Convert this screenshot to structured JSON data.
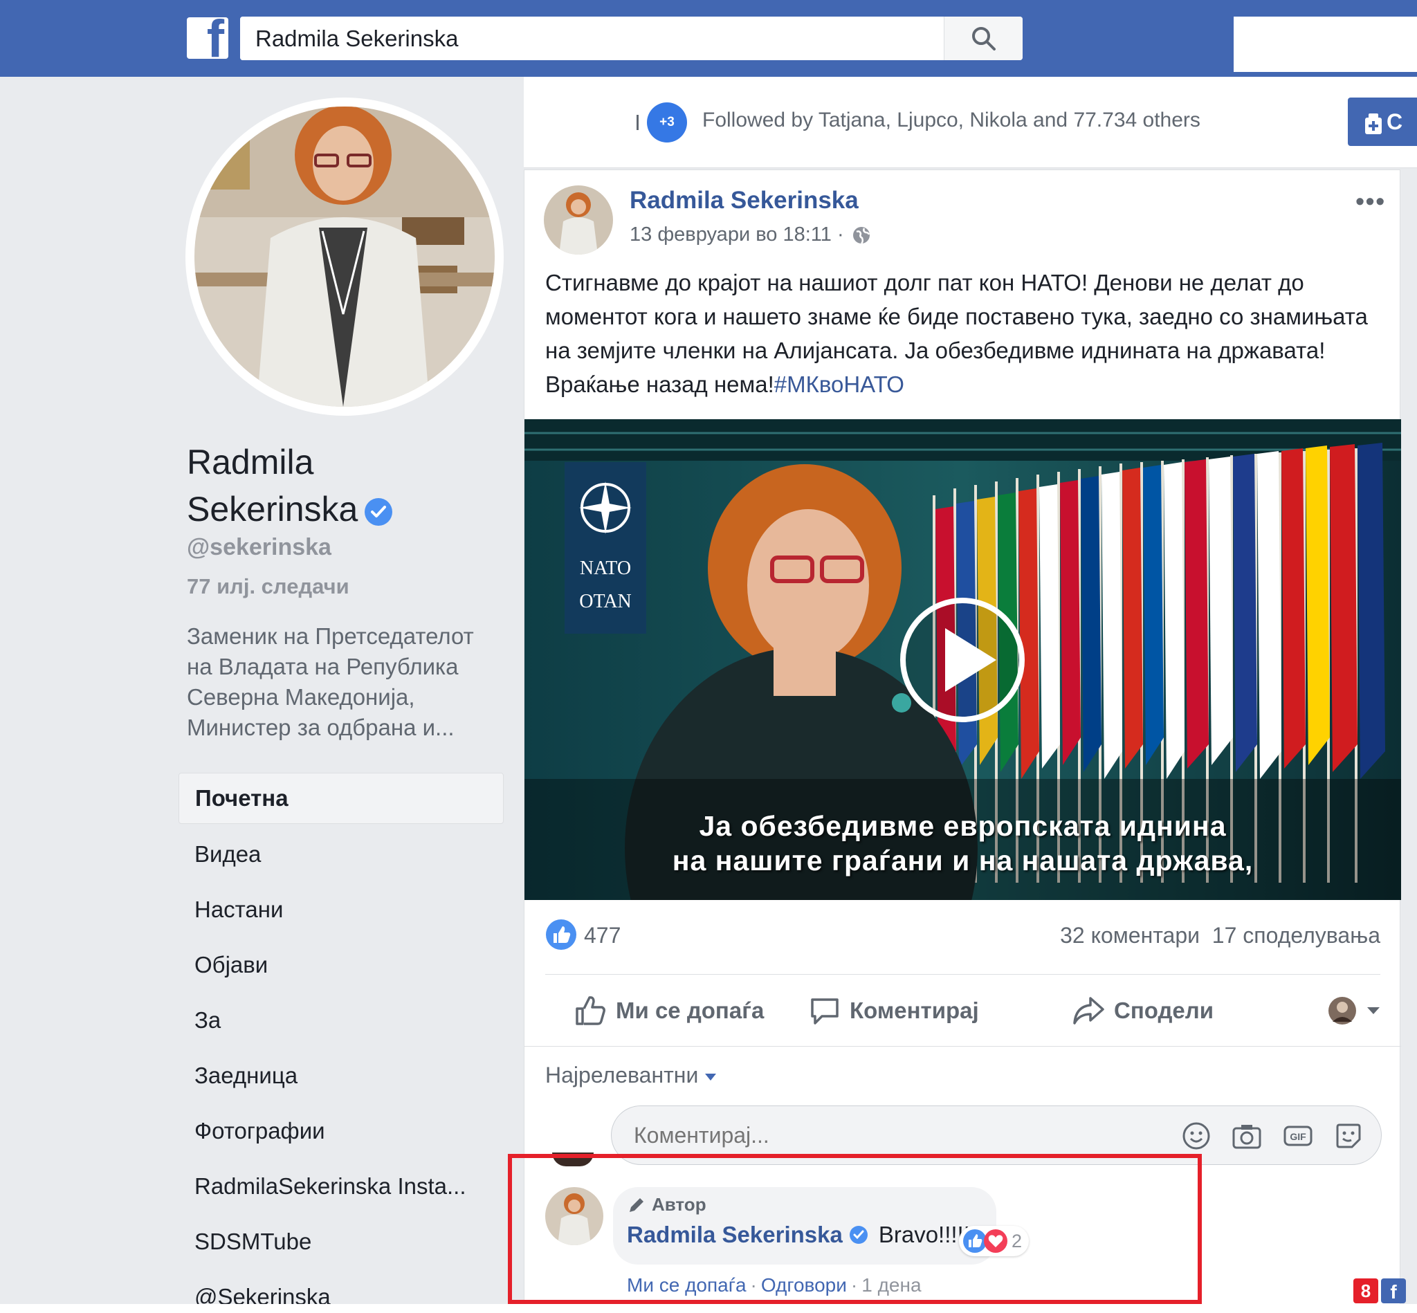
{
  "search": {
    "query": "Radmila Sekerinska"
  },
  "profile": {
    "name": "Radmila Sekerinska",
    "name_line1": "Radmila",
    "name_line2": "Sekerinska",
    "handle": "@sekerinska",
    "followers": "77 илј. следачи",
    "bio": "Заменик на Претседателот на Владата на Република Северна Македонија, Министер за одбрана и..."
  },
  "sidebar": {
    "items": [
      {
        "label": "Почетна",
        "active": true
      },
      {
        "label": "Видеа"
      },
      {
        "label": "Настани"
      },
      {
        "label": "Објави"
      },
      {
        "label": "За"
      },
      {
        "label": "Заедница"
      },
      {
        "label": "Фотографии"
      },
      {
        "label": "RadmilaSekerinska Insta..."
      },
      {
        "label": "SDSMTube"
      },
      {
        "label": "@Sekerinska"
      }
    ]
  },
  "followed": {
    "badge": "+3",
    "text": "Followed by Tatjana, Ljupco, Nikola and 77.734 others",
    "cta_label": "C"
  },
  "post": {
    "author": "Radmila Sekerinska",
    "date": "13 февруари во 18:11 ·",
    "text": "Стигнавме до крајот на нашиот долг пат кон НАТО! Денови не делат до моментот кога и нашето знаме ќе биде поставено тука, заедно со знамињата на земјите членки на Алијансата. Ја обезбедивме иднината на државата! Враќање назад нема!",
    "hashtag": "#МКвоНАТО",
    "video": {
      "sign_line1": "NATO",
      "sign_line2": "OTAN",
      "subtitle_line1": "Ја обезбедивме европската иднина",
      "subtitle_line2": "на нашите граѓани и на нашата држава,"
    },
    "likes": "477",
    "comments_count": "32 коментари",
    "shares_count": "17 споделувања",
    "actions": {
      "like": "Ми се допаѓа",
      "comment": "Коментирај",
      "share": "Сподели"
    },
    "sort_label": "Најрелевантни",
    "comment_placeholder": "Коментирај..."
  },
  "comment": {
    "tag": "Автор",
    "author": "Radmila Sekerinska",
    "text": "Bravo!!!!!!",
    "reactions": "2",
    "like_link": "Ми се допаѓа",
    "reply_link": "Одговори",
    "time": "1 дена"
  },
  "corner": {
    "badge_number": "8",
    "badge_fb": "f"
  },
  "colors": {
    "brand": "#4267b2",
    "link": "#365899",
    "highlight": "#e5202a"
  }
}
